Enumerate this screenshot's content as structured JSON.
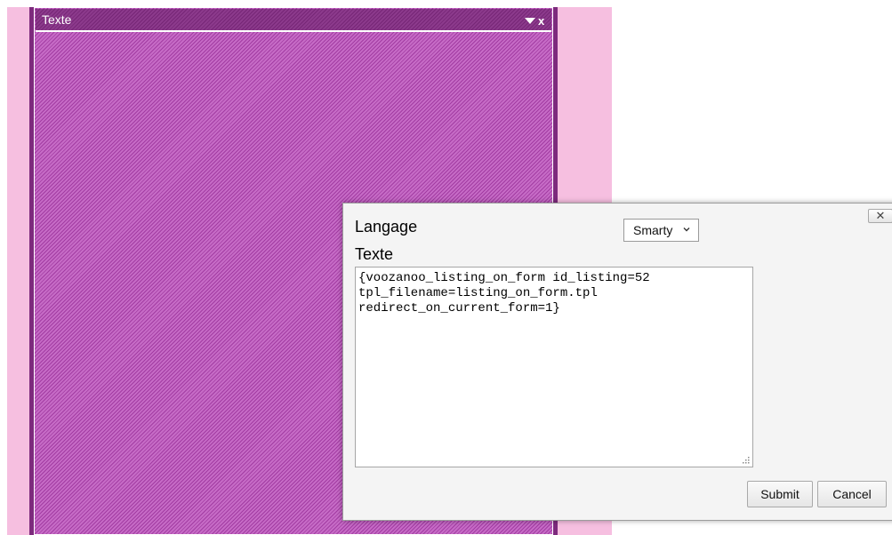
{
  "widget": {
    "title": "Texte",
    "close_label": "x",
    "colors": {
      "pink_background": "#f6bfe0",
      "widget_purple": "#b04bb0",
      "header_purple": "#7d2a7d"
    }
  },
  "dialog": {
    "close_label": "✕",
    "language_label": "Langage",
    "language_selected": "Smarty",
    "text_label": "Texte",
    "text_value": "{voozanoo_listing_on_form id_listing=52\ntpl_filename=listing_on_form.tpl\nredirect_on_current_form=1}",
    "submit_label": "Submit",
    "cancel_label": "Cancel"
  }
}
